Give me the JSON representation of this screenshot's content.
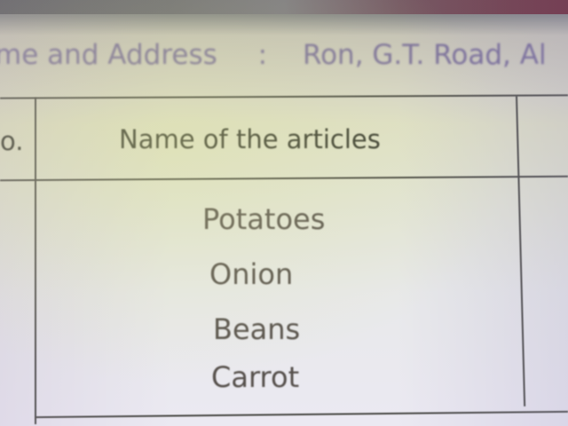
{
  "header_line": {
    "label": "me and Address",
    "separator": ":",
    "value": "Ron, G.T. Road, Al"
  },
  "table": {
    "columns": [
      "o.",
      "Name of the articles"
    ],
    "rows": [
      "Potatoes",
      "Onion",
      "Beans",
      "Carrot"
    ]
  }
}
